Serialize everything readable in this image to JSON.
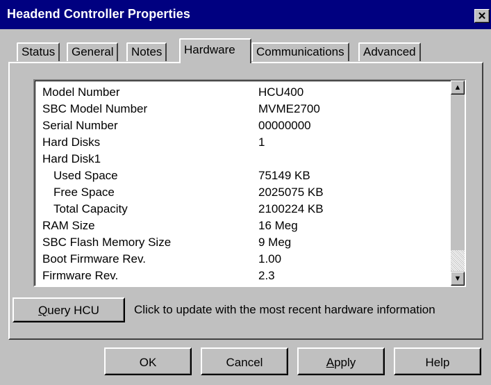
{
  "window": {
    "title": "Headend Controller Properties"
  },
  "tabs": [
    {
      "label": "Status"
    },
    {
      "label": "General"
    },
    {
      "label": "Notes"
    },
    {
      "label": "Hardware",
      "active": true
    },
    {
      "label": "Communications"
    },
    {
      "label": "Advanced"
    }
  ],
  "hardware": {
    "rows": [
      {
        "label": "Model Number",
        "value": "HCU400"
      },
      {
        "label": "SBC Model Number",
        "value": "MVME2700"
      },
      {
        "label": "Serial Number",
        "value": "00000000"
      },
      {
        "label": "Hard Disks",
        "value": "1"
      },
      {
        "label": "Hard Disk1",
        "value": ""
      },
      {
        "label": "Used Space",
        "value": "75149 KB"
      },
      {
        "label": "Free Space",
        "value": "2025075 KB"
      },
      {
        "label": "Total Capacity",
        "value": "2100224 KB"
      },
      {
        "label": "RAM Size",
        "value": "16 Meg"
      },
      {
        "label": "SBC Flash Memory Size",
        "value": "9 Meg"
      },
      {
        "label": "Boot Firmware Rev.",
        "value": "1.00"
      },
      {
        "label": "Firmware Rev.",
        "value": "2.3"
      }
    ],
    "query_button": {
      "label_underlined": "Q",
      "label_rest": "uery HCU"
    },
    "query_hint": "Click to update with the most recent hardware information"
  },
  "buttons": {
    "ok": "OK",
    "cancel": "Cancel",
    "apply_underlined": "A",
    "apply_rest": "pply",
    "help": "Help"
  },
  "icons": {
    "close": "close-icon",
    "scroll_up": "scroll-up-arrow-icon",
    "scroll_down": "scroll-down-arrow-icon"
  },
  "colors": {
    "titlebar": "#000080",
    "face": "#c0c0c0",
    "list_bg": "#ffffff"
  }
}
